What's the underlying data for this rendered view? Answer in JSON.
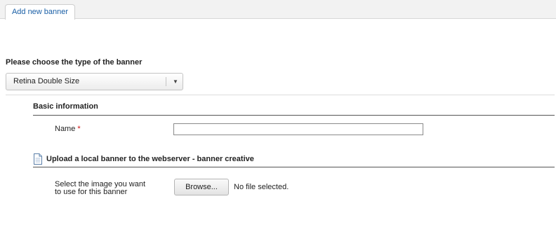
{
  "tabs": [
    {
      "label": "Add new banner",
      "active": true
    }
  ],
  "banner_type": {
    "label": "Please choose the type of the banner",
    "selected": "Retina Double Size"
  },
  "basic_info": {
    "title": "Basic information",
    "name_label": "Name",
    "required_mark": "*",
    "name_value": ""
  },
  "upload": {
    "title": "Upload a local banner to the webserver - banner creative",
    "field_label_line1": "Select the image you want",
    "field_label_line2": "to use for this banner",
    "browse_label": "Browse...",
    "file_status": "No file selected."
  },
  "colors": {
    "tab_text": "#1a5fa6",
    "required": "#d01010"
  }
}
